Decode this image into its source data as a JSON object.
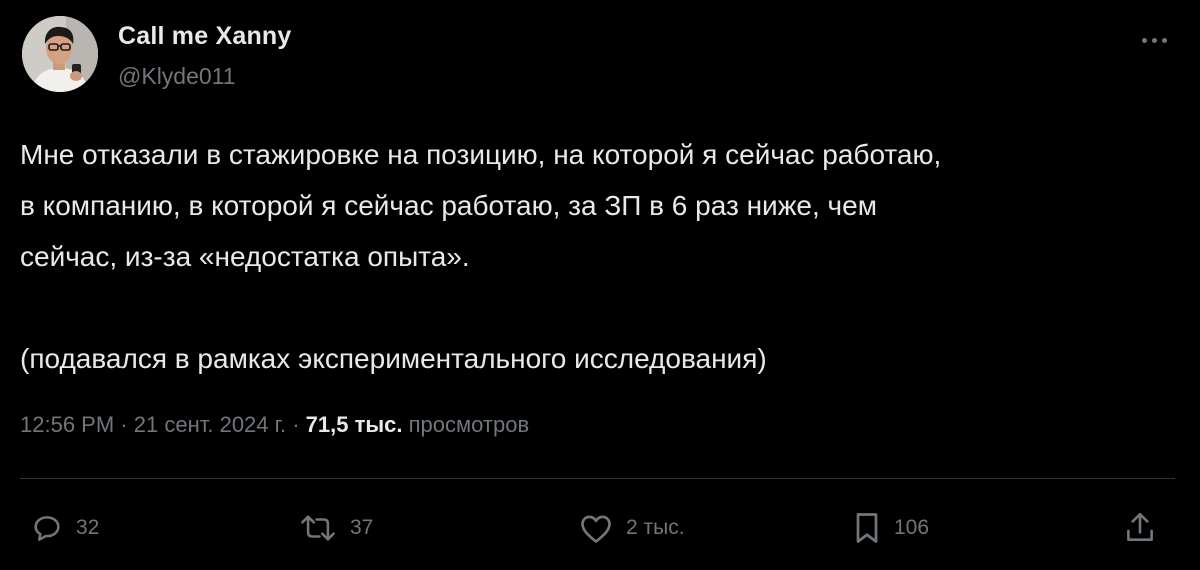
{
  "author": {
    "display_name": "Call me Xanny",
    "handle": "@Klyde011",
    "avatar_icon": "avatar-photo"
  },
  "tweet": {
    "lines": [
      "Мне отказали в стажировке на позицию, на которой я сейчас работаю,",
      "в компанию, в которой я сейчас работаю, за ЗП в 6 раз ниже, чем",
      "сейчас, из-за «недостатка опыта»."
    ],
    "note": "(подавался в рамках экспериментального исследования)"
  },
  "meta": {
    "time": "12:56 PM",
    "separator": "·",
    "date": "21 сент. 2024 г.",
    "views_count": "71,5 тыс.",
    "views_label": "просмотров"
  },
  "actions": {
    "reply": {
      "icon": "reply-icon",
      "count": "32"
    },
    "retweet": {
      "icon": "retweet-icon",
      "count": "37"
    },
    "like": {
      "icon": "heart-icon",
      "count": "2 тыс."
    },
    "bookmark": {
      "icon": "bookmark-icon",
      "count": "106"
    },
    "share": {
      "icon": "share-icon"
    }
  },
  "colors": {
    "background": "#000000",
    "text_primary": "#e7e9ea",
    "text_secondary": "#71767b",
    "divider": "#2f3336"
  }
}
